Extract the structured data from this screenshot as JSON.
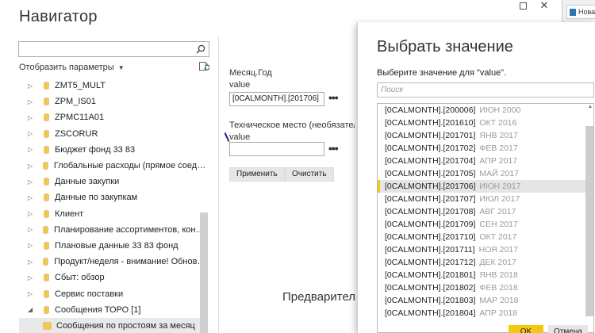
{
  "navigator": {
    "title": "Навигатор",
    "display_options": "Отобразить параметры",
    "tree": [
      {
        "label": "ZMT5_MULT"
      },
      {
        "label": "ZPM_IS01"
      },
      {
        "label": "ZPMC11A01"
      },
      {
        "label": "ZSCORUR"
      },
      {
        "label": "Бюджет фонд 33 83"
      },
      {
        "label": "Глобальные расходы (прямое соединен..."
      },
      {
        "label": "Данные закупки"
      },
      {
        "label": "Данные по закупкам"
      },
      {
        "label": "Клиент"
      },
      {
        "label": "Планирование ассортиментов, контрол..."
      },
      {
        "label": "Плановые данные 33 83 фонд"
      },
      {
        "label": "Продукт/неделя - внимание! Обновите..."
      },
      {
        "label": "Сбыт: обзор"
      },
      {
        "label": "Сервис поставки"
      },
      {
        "label": "Сообщения ТОРО [1]"
      }
    ],
    "tree_child": "Сообщения по простоям за месяц",
    "preview_text": "Предварител"
  },
  "params": {
    "field1_label": "Месяц.Год",
    "field1_sublabel": "value",
    "field1_value": "[0CALMONTH].[201706]",
    "field2_label": "Техническое место (необязательно)",
    "field2_sublabel": "value",
    "field2_value": "",
    "more": "•••",
    "apply": "Применить",
    "clear": "Очистить"
  },
  "side": {
    "new_label": "Нова"
  },
  "dialog": {
    "title": "Выбрать значение",
    "subtitle": "Выберите значение для \"value\".",
    "search_placeholder": "Поиск",
    "items": [
      {
        "code": "[0CALMONTH].[200006]",
        "hint": "ИЮН 2000"
      },
      {
        "code": "[0CALMONTH].[201610]",
        "hint": "ОКТ 2016"
      },
      {
        "code": "[0CALMONTH].[201701]",
        "hint": "ЯНВ 2017"
      },
      {
        "code": "[0CALMONTH].[201702]",
        "hint": "ФЕВ 2017"
      },
      {
        "code": "[0CALMONTH].[201704]",
        "hint": "АПР 2017"
      },
      {
        "code": "[0CALMONTH].[201705]",
        "hint": "МАЙ 2017"
      },
      {
        "code": "[0CALMONTH].[201706]",
        "hint": "ИЮН 2017"
      },
      {
        "code": "[0CALMONTH].[201707]",
        "hint": "ИЮЛ 2017"
      },
      {
        "code": "[0CALMONTH].[201708]",
        "hint": "АВГ 2017"
      },
      {
        "code": "[0CALMONTH].[201709]",
        "hint": "СЕН 2017"
      },
      {
        "code": "[0CALMONTH].[201710]",
        "hint": "ОКТ 2017"
      },
      {
        "code": "[0CALMONTH].[201711]",
        "hint": "НОЯ 2017"
      },
      {
        "code": "[0CALMONTH].[201712]",
        "hint": "ДЕК 2017"
      },
      {
        "code": "[0CALMONTH].[201801]",
        "hint": "ЯНВ 2018"
      },
      {
        "code": "[0CALMONTH].[201802]",
        "hint": "ФЕВ 2018"
      },
      {
        "code": "[0CALMONTH].[201803]",
        "hint": "МАР 2018"
      },
      {
        "code": "[0CALMONTH].[201804]",
        "hint": "АПР 2018"
      }
    ],
    "selected_index": 6,
    "ok": "OK",
    "cancel": "Отмена"
  },
  "colors": {
    "accent": "#f2c811",
    "db_icon": "#f0c660"
  }
}
